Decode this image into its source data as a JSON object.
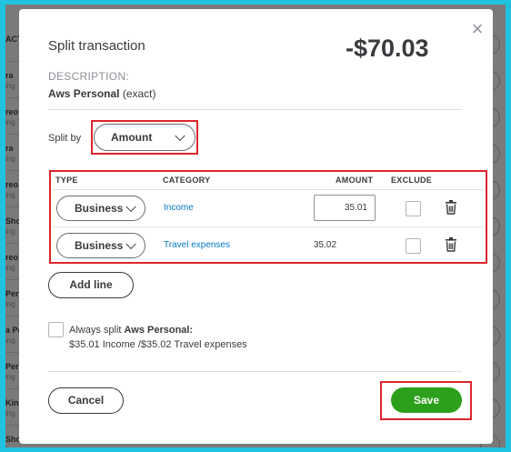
{
  "background": {
    "rows": [
      {
        "name": "ACTI",
        "sub": ""
      },
      {
        "name": "ra",
        "sub": "ing"
      },
      {
        "name": "reo",
        "sub": "ing"
      },
      {
        "name": "ra",
        "sub": "ing"
      },
      {
        "name": "reo",
        "sub": "ing"
      },
      {
        "name": "Sho",
        "sub": "ing"
      },
      {
        "name": "reo",
        "sub": "ing"
      },
      {
        "name": "Per",
        "sub": "ing"
      },
      {
        "name": "a Per",
        "sub": "ing"
      },
      {
        "name": "Per",
        "sub": "ing"
      },
      {
        "name": "Kin",
        "sub": "ing"
      },
      {
        "name": "Sho",
        "sub": "ing"
      }
    ]
  },
  "modal": {
    "close_icon": "close-icon",
    "title": "Split transaction",
    "total": "-$70.03",
    "description_label": "DESCRIPTION:",
    "description_merchant": "Aws Personal",
    "description_match": "(exact)",
    "split_by_label": "Split by",
    "split_by_value": "Amount",
    "table": {
      "headers": {
        "type": "TYPE",
        "category": "CATEGORY",
        "amount": "AMOUNT",
        "exclude": "EXCLUDE"
      },
      "rows": [
        {
          "type": "Business",
          "category": "Income",
          "amount": "35.01",
          "excluded": false
        },
        {
          "type": "Business",
          "category": "Travel expenses",
          "amount": "35.02",
          "excluded": false
        }
      ]
    },
    "add_line_label": "Add line",
    "always_split_prefix": "Always split ",
    "always_split_merchant": "Aws Personal:",
    "always_split_detail": "$35.01 Income /$35.02 Travel expenses",
    "cancel_label": "Cancel",
    "save_label": "Save",
    "colors": {
      "highlight": "#d9262c",
      "save": "#2ca01c",
      "link": "#0077c5",
      "frame": "#1fc3e0"
    }
  }
}
